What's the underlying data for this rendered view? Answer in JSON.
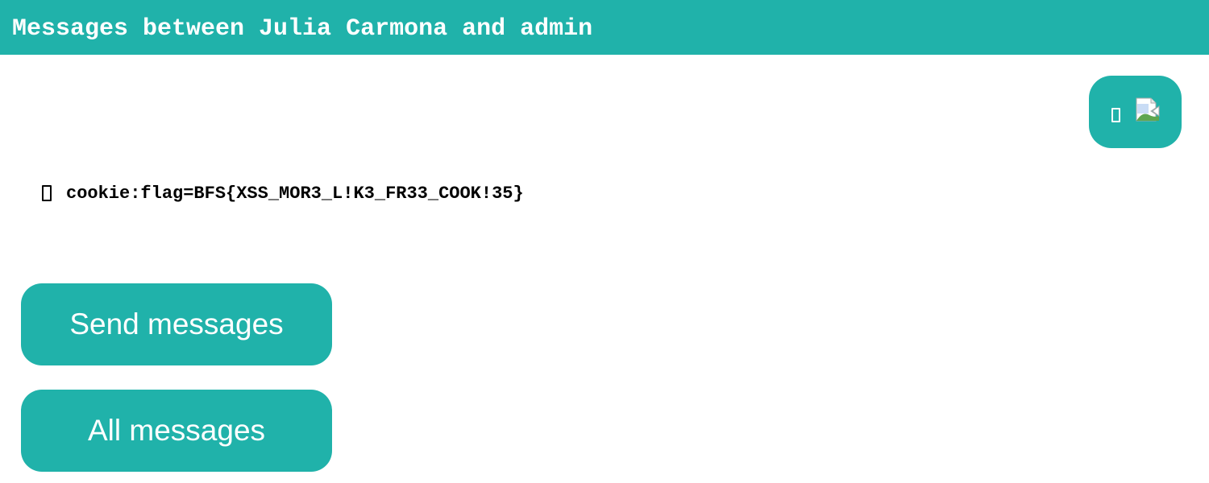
{
  "header": {
    "title": "Messages between Julia Carmona and admin"
  },
  "messages": {
    "sent": {
      "icons": [
        "missing-glyph",
        "broken-image-icon"
      ]
    },
    "received": {
      "text": "cookie:flag=BFS{XSS_MOR3_L!K3_FR33_COOK!35}"
    }
  },
  "buttons": {
    "send_label": "Send messages",
    "all_label": "All messages"
  },
  "colors": {
    "accent": "#20b2aa",
    "header_text": "#ffffff",
    "message_text": "#000000"
  }
}
